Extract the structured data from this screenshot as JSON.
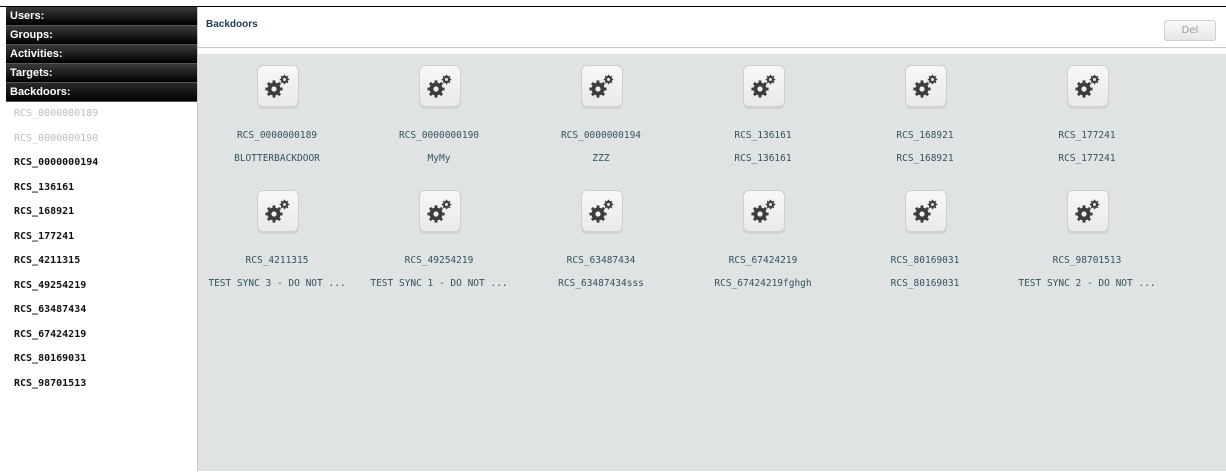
{
  "sidebar": {
    "sections": [
      {
        "label": "Users:"
      },
      {
        "label": "Groups:"
      },
      {
        "label": "Activities:"
      },
      {
        "label": "Targets:"
      },
      {
        "label": "Backdoors:"
      }
    ],
    "items": [
      {
        "label": "RCS_0000000189",
        "dimmed": true
      },
      {
        "label": "RCS_0000000190",
        "dimmed": true
      },
      {
        "label": "RCS_0000000194",
        "dimmed": false
      },
      {
        "label": "RCS_136161",
        "dimmed": false
      },
      {
        "label": "RCS_168921",
        "dimmed": false
      },
      {
        "label": "RCS_177241",
        "dimmed": false
      },
      {
        "label": "RCS_4211315",
        "dimmed": false
      },
      {
        "label": "RCS_49254219",
        "dimmed": false
      },
      {
        "label": "RCS_63487434",
        "dimmed": false
      },
      {
        "label": "RCS_67424219",
        "dimmed": false
      },
      {
        "label": "RCS_80169031",
        "dimmed": false
      },
      {
        "label": "RCS_98701513",
        "dimmed": false
      }
    ]
  },
  "header": {
    "title": "Backdoors",
    "del_label": "Del"
  },
  "backdoors": [
    {
      "name": "RCS_0000000189",
      "desc": "BLOTTERBACKDOOR",
      "icon": "gears-icon"
    },
    {
      "name": "RCS_0000000190",
      "desc": "MyMy",
      "icon": "gears-icon"
    },
    {
      "name": "RCS_0000000194",
      "desc": "ZZZ",
      "icon": "gears-icon"
    },
    {
      "name": "RCS_136161",
      "desc": "RCS_136161",
      "icon": "gears-icon"
    },
    {
      "name": "RCS_168921",
      "desc": "RCS_168921",
      "icon": "gears-icon"
    },
    {
      "name": "RCS_177241",
      "desc": "RCS_177241",
      "icon": "gears-icon"
    },
    {
      "name": "RCS_4211315",
      "desc": "TEST SYNC 3 - DO NOT ...",
      "icon": "gears-icon"
    },
    {
      "name": "RCS_49254219",
      "desc": "TEST SYNC 1 - DO NOT ...",
      "icon": "gears-icon"
    },
    {
      "name": "RCS_63487434",
      "desc": "RCS_63487434sss",
      "icon": "gears-icon"
    },
    {
      "name": "RCS_67424219",
      "desc": "RCS_67424219fghgh",
      "icon": "gears-icon"
    },
    {
      "name": "RCS_80169031",
      "desc": "RCS_80169031",
      "icon": "gears-icon"
    },
    {
      "name": "RCS_98701513",
      "desc": "TEST SYNC 2 - DO NOT ...",
      "icon": "gears-icon"
    }
  ],
  "colors": {
    "header_bg": "#000000",
    "content_bg": "#dfe3e4",
    "title_color": "#1c3c54",
    "tile_text": "#34525f",
    "dim_text": "#bdbdbd"
  }
}
